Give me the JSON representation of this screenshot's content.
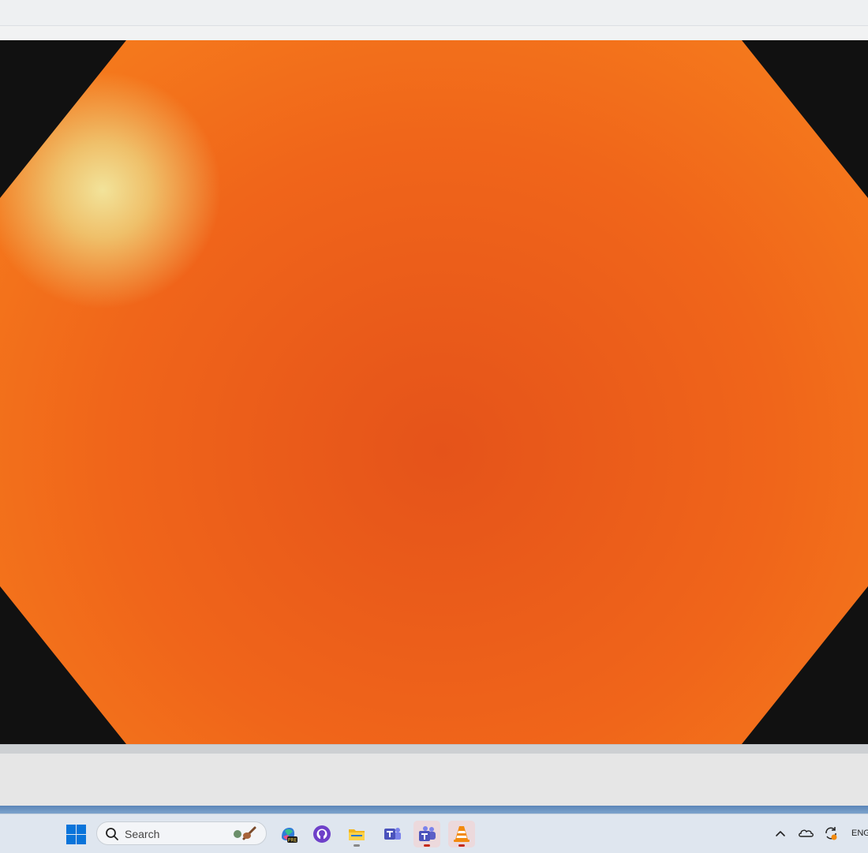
{
  "taskbar": {
    "search_label": "Search",
    "tray_language": "ENG",
    "apps": [
      {
        "name": "copilot-icon",
        "badge": "PRE"
      },
      {
        "name": "github-icon"
      },
      {
        "name": "file-explorer-icon"
      },
      {
        "name": "teams-classic-icon"
      },
      {
        "name": "teams-icon"
      },
      {
        "name": "vlc-icon"
      }
    ]
  },
  "colors": {
    "video_orange": "#f0651a",
    "letterbox": "#111111",
    "taskbar_bg": "#dfe6ef",
    "windows_blue": "#0a74da"
  }
}
